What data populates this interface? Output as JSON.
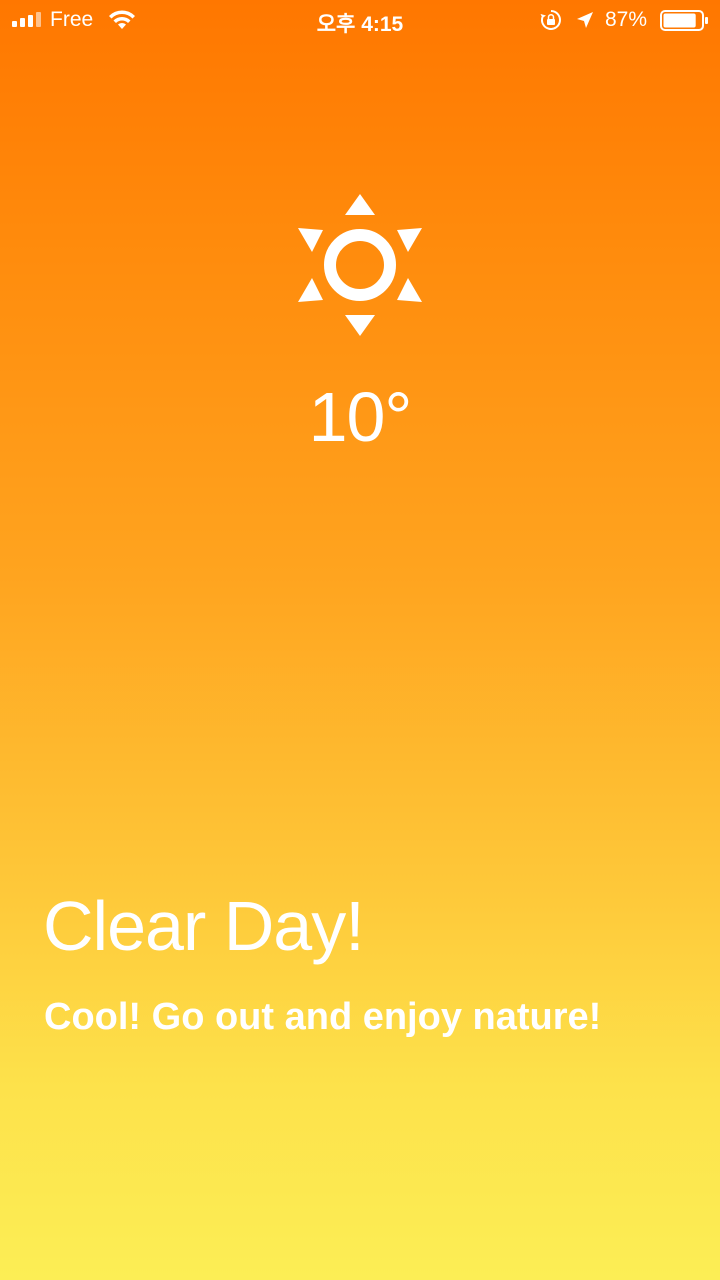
{
  "status_bar": {
    "carrier": "Free",
    "time": "오후 4:15",
    "battery_percent": "87%",
    "battery_level": 0.87,
    "icons": [
      "signal-icon",
      "wifi-icon",
      "rotation-lock-icon",
      "location-arrow-icon",
      "battery-icon"
    ]
  },
  "weather": {
    "icon": "sun-icon",
    "temperature": "10°",
    "condition": "Clear Day!",
    "message": "Cool! Go out and enjoy nature!"
  },
  "colors": {
    "gradient_top": "#ff7700",
    "gradient_bottom": "#fcee55",
    "text": "#ffffff"
  }
}
